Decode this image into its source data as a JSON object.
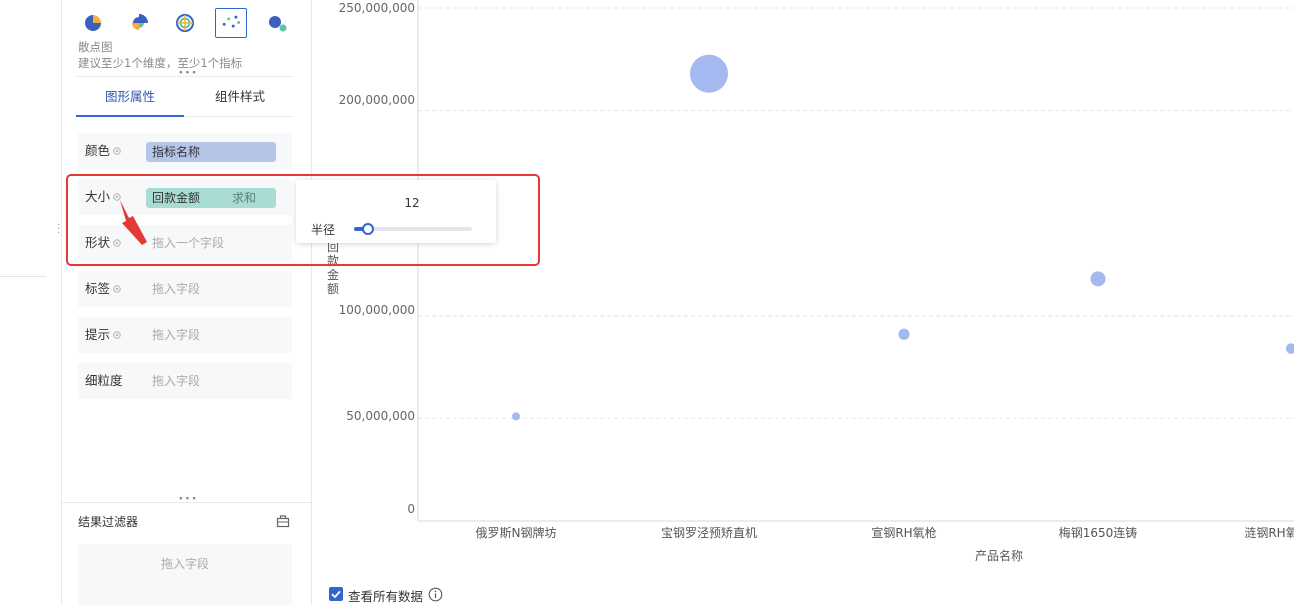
{
  "chart_type_panel": {
    "icons": [
      "pie-chart-icon",
      "rose-chart-icon",
      "radar-chart-icon",
      "scatter-chart-icon",
      "bubble-chart-icon"
    ],
    "selected_name": "散点图",
    "hint": "建议至少1个维度，至少1个指标"
  },
  "tabs": [
    "图形属性",
    "组件样式"
  ],
  "fields": {
    "color": {
      "label": "颜色",
      "pill": "指标名称"
    },
    "size": {
      "label": "大小",
      "pill": "回款金额",
      "agg": "求和"
    },
    "shape": {
      "label": "形状",
      "placeholder": "拖入一个字段"
    },
    "label": {
      "label": "标签",
      "placeholder": "拖入字段"
    },
    "tooltip": {
      "label": "提示",
      "placeholder": "拖入字段"
    },
    "granularity": {
      "label": "细粒度",
      "placeholder": "拖入字段"
    }
  },
  "filter": {
    "title": "结果过滤器",
    "placeholder": "拖入字段"
  },
  "size_popup": {
    "value": "12",
    "label": "半径",
    "slider_fraction": 0.12
  },
  "view_all": {
    "label": "查看所有数据",
    "checked": true
  },
  "colors": {
    "accent": "#3366cc",
    "bubble": "#a4b9ef",
    "annotation": "#e53935"
  },
  "chart_data": {
    "type": "scatter",
    "xlabel": "产品名称",
    "ylabel": "回款金额",
    "ylim": [
      0,
      250000000
    ],
    "yticks": [
      "0",
      "50,000,000",
      "100,000,000",
      "200,000,000",
      "250,000,000"
    ],
    "ytick_values": [
      0,
      50000000,
      100000000,
      200000000,
      250000000
    ],
    "categories": [
      "俄罗斯N钢牌坊",
      "宝钢罗泾预矫直机",
      "宣钢RH氧枪",
      "梅钢1650连铸",
      "涟钢RH氧"
    ],
    "values": [
      51000000,
      218000000,
      91000000,
      118000000,
      84000000
    ],
    "size_field": "回款金额",
    "grid": true
  }
}
